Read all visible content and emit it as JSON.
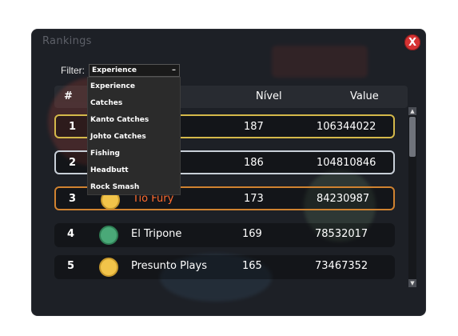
{
  "window": {
    "title": "Rankings",
    "close_label": "X"
  },
  "filter": {
    "label": "Filter:",
    "selected": "Experience",
    "options": [
      "Experience",
      "Catches",
      "Kanto Catches",
      "Johto Catches",
      "Fishing",
      "Headbutt",
      "Rock Smash"
    ]
  },
  "table": {
    "headers": {
      "rank": "#",
      "level": "Nível",
      "value": "Value"
    },
    "rows": [
      {
        "rank": "1",
        "name": "",
        "level": "187",
        "value": "106344022"
      },
      {
        "rank": "2",
        "name": "",
        "level": "186",
        "value": "104810846"
      },
      {
        "rank": "3",
        "name": "Tio Fury",
        "level": "173",
        "value": "84230987"
      },
      {
        "rank": "4",
        "name": "El Tripone",
        "level": "169",
        "value": "78532017"
      },
      {
        "rank": "5",
        "name": "Presunto Plays",
        "level": "165",
        "value": "73467352"
      }
    ]
  },
  "colors": {
    "gold": "#d4b84a",
    "silver": "#c8cfd8",
    "bronze": "#d08230",
    "close": "#d63333"
  }
}
